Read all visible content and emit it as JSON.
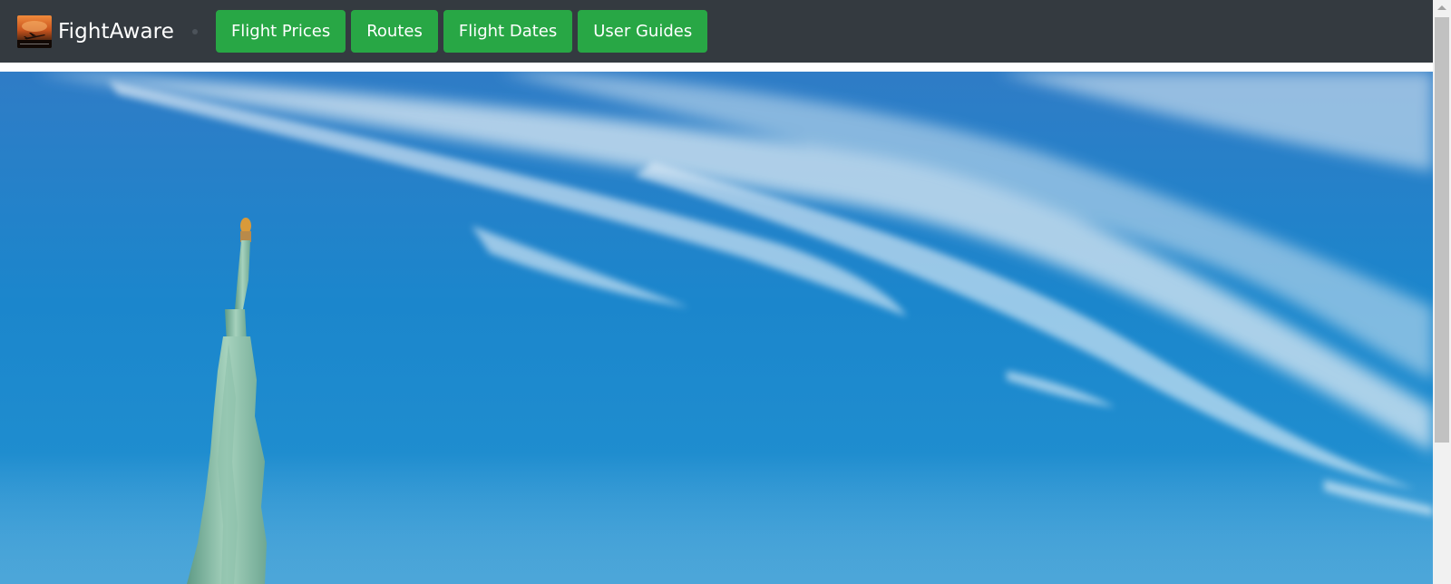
{
  "brand": {
    "name": "FightAware",
    "logo_icon": "sunset-airplane-logo"
  },
  "nav": {
    "buttons": [
      {
        "label": "Flight Prices",
        "icon": null
      },
      {
        "label": "Routes",
        "icon": null
      },
      {
        "label": "Flight Dates",
        "icon": null
      },
      {
        "label": "User Guides",
        "icon": null
      }
    ]
  },
  "hero": {
    "image": "statue-of-liberty-blue-sky"
  },
  "colors": {
    "navbar_bg": "#343a40",
    "button_bg": "#28a745",
    "button_text": "#ffffff",
    "sky_top": "#2f7fc8",
    "sky_bottom": "#1a8fd0"
  }
}
